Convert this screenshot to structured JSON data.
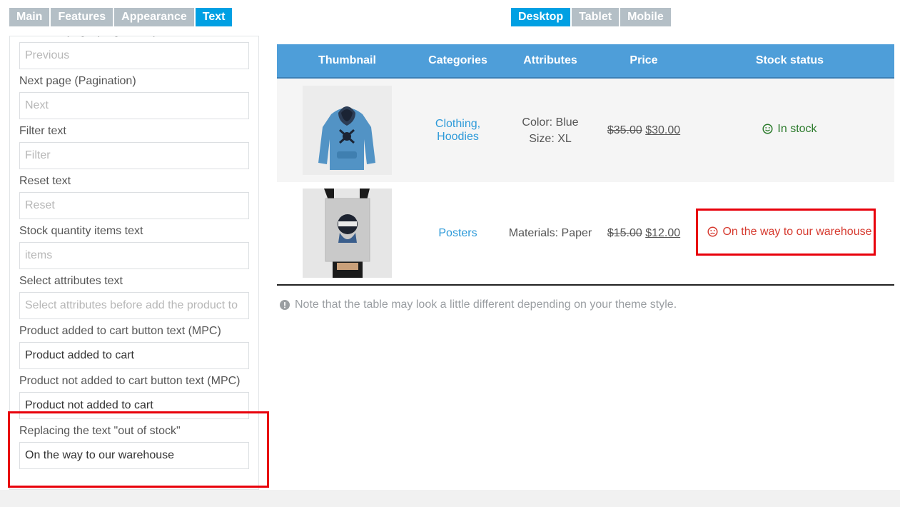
{
  "settings_tabs": [
    {
      "label": "Main",
      "active": false
    },
    {
      "label": "Features",
      "active": false
    },
    {
      "label": "Appearance",
      "active": false
    },
    {
      "label": "Text",
      "active": true
    }
  ],
  "device_tabs": [
    {
      "label": "Desktop",
      "active": true
    },
    {
      "label": "Tablet",
      "active": false
    },
    {
      "label": "Mobile",
      "active": false
    }
  ],
  "settings": {
    "fields": [
      {
        "label": "Previous page (Pagination)",
        "value": "",
        "placeholder": "Previous"
      },
      {
        "label": "Next page (Pagination)",
        "value": "",
        "placeholder": "Next"
      },
      {
        "label": "Filter text",
        "value": "",
        "placeholder": "Filter"
      },
      {
        "label": "Reset text",
        "value": "",
        "placeholder": "Reset"
      },
      {
        "label": "Stock quantity items text",
        "value": "",
        "placeholder": "items"
      },
      {
        "label": "Select attributes text",
        "value": "",
        "placeholder": "Select attributes before add the product to"
      },
      {
        "label": "Product added to cart button text (MPC)",
        "value": "Product added to cart",
        "placeholder": ""
      },
      {
        "label": "Product not added to cart button text (MPC)",
        "value": "Product not added to cart",
        "placeholder": ""
      },
      {
        "label": "Replacing the text \"out of stock\"",
        "value": "On the way to our warehouse",
        "placeholder": ""
      }
    ]
  },
  "table": {
    "headers": [
      "Thumbnail",
      "Categories",
      "Attributes",
      "Price",
      "Stock status"
    ],
    "rows": [
      {
        "thumbnail_icon": "hoodie-image",
        "categories": "Clothing, Hoodies",
        "attributes": [
          "Color: Blue",
          "Size: XL"
        ],
        "old_price": "$35.00",
        "new_price": "$30.00",
        "stock_text": "In stock",
        "stock_icon": "smile-icon",
        "stock_color": "#2b7a2b"
      },
      {
        "thumbnail_icon": "poster-image",
        "categories": "Posters",
        "attributes": [
          "Materials: Paper"
        ],
        "old_price": "$15.00",
        "new_price": "$12.00",
        "stock_text": "On the way to our warehouse",
        "stock_icon": "frown-icon",
        "stock_color": "#d63a2f"
      }
    ]
  },
  "note": "Note that the table may look a little different depending on your theme style.",
  "colors": {
    "accent": "#00a0e3",
    "header": "#4e9ed9",
    "highlight": "#e8000b"
  }
}
